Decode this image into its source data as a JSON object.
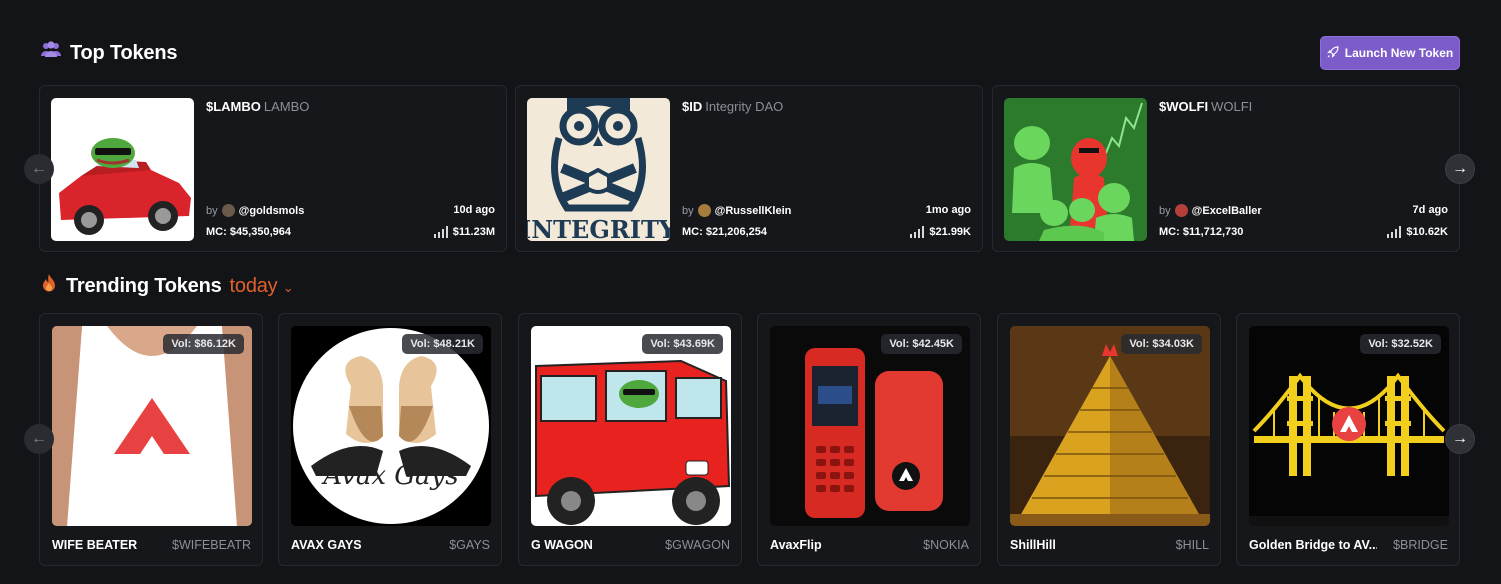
{
  "top_section": {
    "title": "Top Tokens",
    "launch_button": "Launch New Token",
    "tokens": [
      {
        "ticker": "$LAMBO",
        "name": "LAMBO",
        "by": "by",
        "user": "@goldsmols",
        "age": "10d ago",
        "mc": "MC: $45,350,964",
        "volume": "$11.23M",
        "image": "pepe-in-red-lamborghini"
      },
      {
        "ticker": "$ID",
        "name": "Integrity DAO",
        "by": "by",
        "user": "@RussellKlein",
        "age": "1mo ago",
        "mc": "MC: $21,206,254",
        "volume": "$21.99K",
        "image": "owl-integrity-logo"
      },
      {
        "ticker": "$WOLFI",
        "name": "WOLFI",
        "by": "by",
        "user": "@ExcelBaller",
        "age": "7d ago",
        "mc": "MC: $11,712,730",
        "volume": "$10.62K",
        "image": "green-wolf-group"
      }
    ]
  },
  "trending_section": {
    "title": "Trending Tokens",
    "period": "today",
    "tokens": [
      {
        "name": "WIFE BEATER",
        "ticker": "$WIFEBEATR",
        "volume": "Vol: $86.12K",
        "image": "white-tank-top-avax-logo"
      },
      {
        "name": "AVAX GAYS",
        "ticker": "$GAYS",
        "volume": "Vol: $48.21K",
        "image": "bearded-men-circle",
        "image_text": "Avax Gays"
      },
      {
        "name": "G WAGON",
        "ticker": "$GWAGON",
        "volume": "Vol: $43.69K",
        "image": "pepe-in-red-g-wagon"
      },
      {
        "name": "AvaxFlip",
        "ticker": "$NOKIA",
        "volume": "Vol: $42.45K",
        "image": "red-flip-phones"
      },
      {
        "name": "ShillHill",
        "ticker": "$HILL",
        "volume": "Vol: $34.03K",
        "image": "golden-pyramid"
      },
      {
        "name": "Golden Bridge to AV...",
        "ticker": "$BRIDGE",
        "volume": "Vol: $32.52K",
        "image": "golden-gate-bridge-avax"
      }
    ]
  },
  "colors": {
    "background": "#131417",
    "card": "#16171b",
    "accent_purple": "#7b5cc9",
    "accent_orange": "#e0612a",
    "avax_red": "#e84142"
  },
  "icons": [
    "users-icon",
    "rocket-icon",
    "fire-icon",
    "chevron-down-icon",
    "arrow-left-icon",
    "arrow-right-icon",
    "volume-bars-icon"
  ]
}
